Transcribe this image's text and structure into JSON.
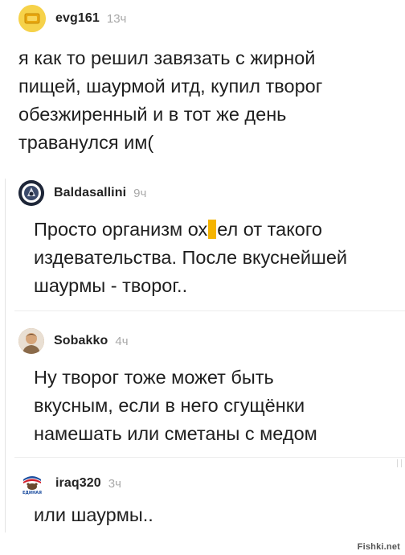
{
  "comments": [
    {
      "username": "evg161",
      "time": "13ч",
      "lines": [
        "я как то решил завязать с жирной",
        "пищей, шаурмой итд, купил творог",
        "обезжиренный и в тот же день",
        "траванулся им("
      ],
      "avatar_icon": "yellow-card-avatar-icon",
      "avatar_color": "#f3c420"
    },
    {
      "username": "Baldasallini",
      "time": "9ч",
      "lines": [
        "Просто организм ох",
        "ел от такого",
        "издевательства. После вкуснейшей",
        "шаурмы - творог.."
      ],
      "avatar_icon": "round-emblem-avatar-icon",
      "avatar_color": "#2f3a52"
    },
    {
      "username": "Sobakko",
      "time": "4ч",
      "lines": [
        "Ну творог тоже может быть",
        "вкусным, если в него сгущёнки",
        "намешать или сметаны с медом"
      ],
      "avatar_icon": "user-photo-avatar-icon",
      "avatar_color": "#b98a5e"
    },
    {
      "username": "iraq320",
      "time": "3ч",
      "lines": [
        "или шаурмы.."
      ],
      "avatar_icon": "bear-logo-avatar-icon",
      "avatar_color": "#1e4fa0",
      "avatar_caption": "ЕДИНАЯ"
    }
  ],
  "watermark": "Fishki.net",
  "colors": {
    "censor": "#f5b400",
    "timestamp": "#a9a9a9"
  }
}
